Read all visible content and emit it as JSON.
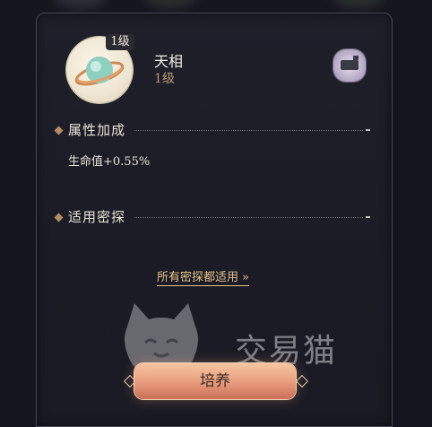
{
  "item": {
    "name": "天相",
    "level_label": "1级",
    "badge_level": "1级",
    "icon": "planet-ring-icon"
  },
  "corner_button": {
    "icon": "rank-scroll-icon"
  },
  "sections": {
    "attributes_title": "属性加成",
    "attribute_value": "生命值+0.55%",
    "applicable_title": "适用密探"
  },
  "apply_all_link": {
    "label": "所有密探都适用",
    "icon": "double-chevron-right-icon"
  },
  "train_button": {
    "label": "培养"
  },
  "watermark": {
    "text": "交易猫",
    "icon": "cat-logo-icon"
  },
  "colors": {
    "accent_gold": "#e4c28a",
    "level_brown": "#b79a6f",
    "panel": "#1d1d27"
  }
}
